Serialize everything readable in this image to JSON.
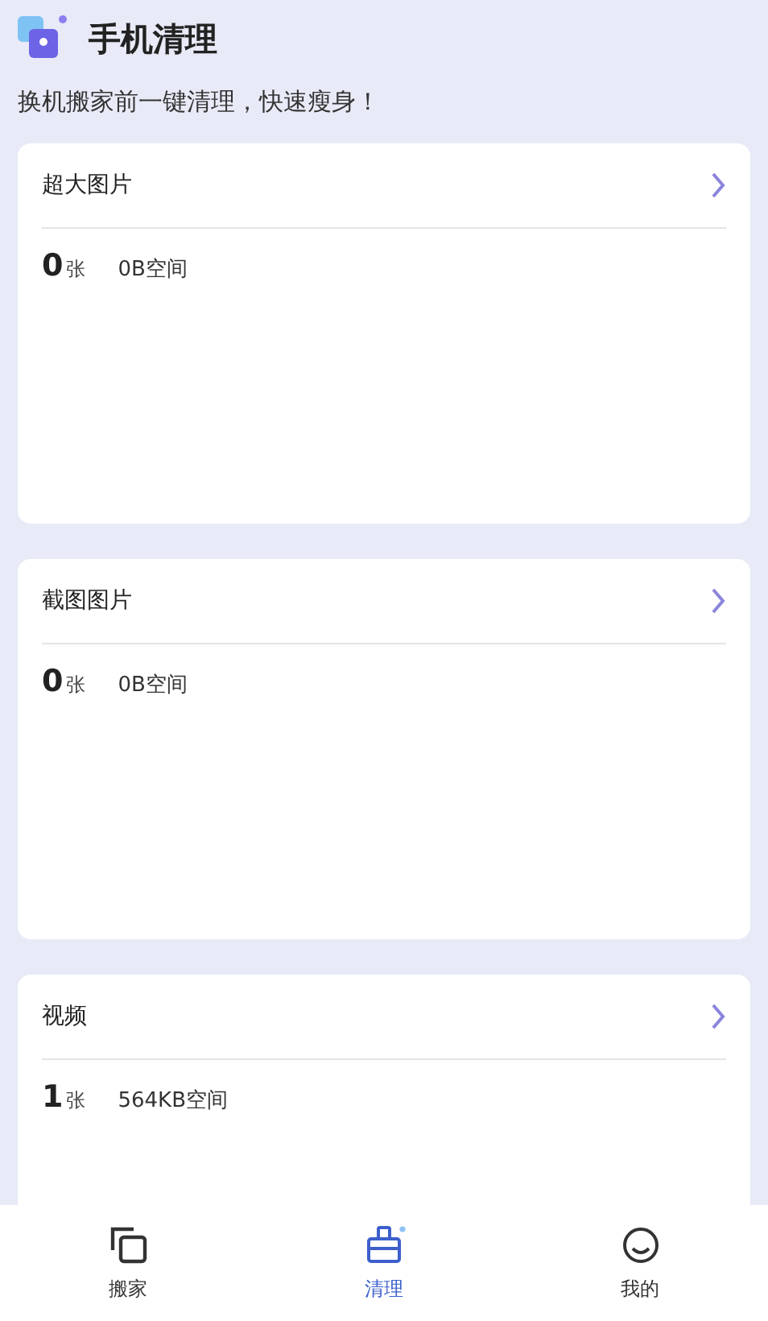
{
  "header": {
    "title": "手机清理",
    "subtitle": "换机搬家前一键清理，快速瘦身！"
  },
  "cards": [
    {
      "title": "超大图片",
      "count": "0",
      "count_unit": "张",
      "size": "0B空间"
    },
    {
      "title": "截图图片",
      "count": "0",
      "count_unit": "张",
      "size": "0B空间"
    },
    {
      "title": "视频",
      "count": "1",
      "count_unit": "张",
      "size": "564KB空间"
    }
  ],
  "tabs": [
    {
      "label": "搬家",
      "kind": "move",
      "selected": false
    },
    {
      "label": "清理",
      "kind": "clean",
      "selected": true
    },
    {
      "label": "我的",
      "kind": "me",
      "selected": false
    }
  ]
}
